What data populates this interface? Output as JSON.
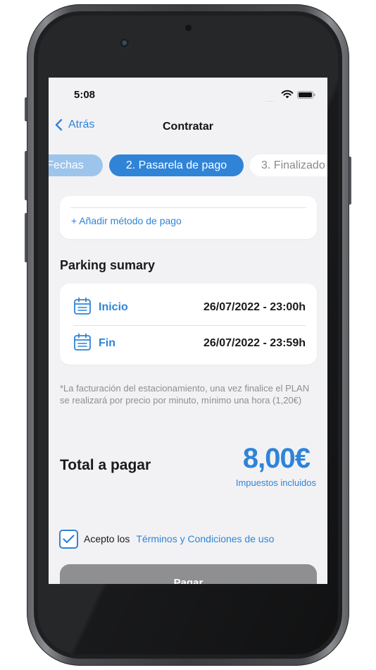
{
  "status_bar": {
    "time": "5:08",
    "signal": "....",
    "icons": [
      "wifi-icon",
      "battery-icon"
    ]
  },
  "nav": {
    "back_label": "Atrás",
    "title": "Contratar"
  },
  "steps": [
    {
      "label": "Fechas",
      "state": "done"
    },
    {
      "label": "2. Pasarela de pago",
      "state": "active"
    },
    {
      "label": "3. Finalizado",
      "state": "pending"
    }
  ],
  "payment": {
    "add_method_label": "+ Añadir método de pago"
  },
  "summary": {
    "title": "Parking sumary",
    "rows": [
      {
        "label": "Inicio",
        "value": "26/07/2022 - 23:00h",
        "icon": "calendar-icon"
      },
      {
        "label": "Fin",
        "value": "26/07/2022 - 23:59h",
        "icon": "calendar-icon"
      }
    ]
  },
  "note": "*La facturación del estacionamiento, una vez finalice el PLAN se realizará por precio por minuto, mínimo una hora (1,20€)",
  "total": {
    "label": "Total a pagar",
    "amount": "8,00€",
    "tax_note": "Impuestos incluidos"
  },
  "terms": {
    "checked": true,
    "accept_label": "Acepto los",
    "link_label": "Términos y Condiciones de uso"
  },
  "pay_button": {
    "label": "Pagar"
  },
  "colors": {
    "accent": "#2f84d8",
    "accent_light": "#9dc5ec",
    "background": "#f2f2f4",
    "button_disabled": "#8f8f92"
  }
}
